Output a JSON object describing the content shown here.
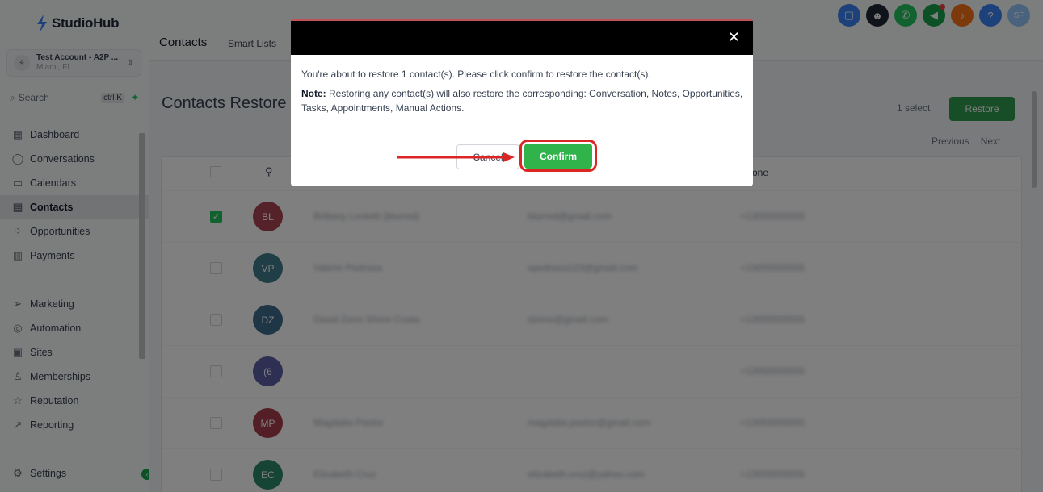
{
  "app": {
    "name": "StudioHub"
  },
  "account": {
    "name": "Test Account - A2P ...",
    "location": "Miami, FL"
  },
  "search": {
    "label": "Search",
    "shortcut": "ctrl K"
  },
  "sidebar": {
    "items": [
      {
        "label": "Dashboard",
        "icon": "dashboard-icon"
      },
      {
        "label": "Conversations",
        "icon": "chat-icon"
      },
      {
        "label": "Calendars",
        "icon": "calendar-icon"
      },
      {
        "label": "Contacts",
        "icon": "contacts-icon",
        "active": true
      },
      {
        "label": "Opportunities",
        "icon": "opportunities-icon"
      },
      {
        "label": "Payments",
        "icon": "payments-icon"
      }
    ],
    "items2": [
      {
        "label": "Marketing",
        "icon": "send-icon"
      },
      {
        "label": "Automation",
        "icon": "automation-icon"
      },
      {
        "label": "Sites",
        "icon": "sites-icon"
      },
      {
        "label": "Memberships",
        "icon": "memberships-icon"
      },
      {
        "label": "Reputation",
        "icon": "star-icon"
      },
      {
        "label": "Reporting",
        "icon": "reporting-icon"
      }
    ],
    "settings": "Settings"
  },
  "topnav": {
    "title": "Contacts",
    "tab": "Smart Lists"
  },
  "page": {
    "title": "Contacts Restore",
    "select_count": "1 select",
    "restore_label": "Restore",
    "previous": "Previous",
    "next": "Next",
    "phone_header": "one"
  },
  "rows": [
    {
      "initials": "BL",
      "color": "#a94450",
      "name": "Brittany Lockett (blurred)",
      "email": "blurred@gmail.com",
      "phone": "+13055555555",
      "checked": true
    },
    {
      "initials": "VP",
      "color": "#3f7d8a",
      "name": "Valerie Pedraza",
      "email": "vpedraza123@gmail.com",
      "phone": "+13055555555",
      "checked": false
    },
    {
      "initials": "DZ",
      "color": "#3f6c8e",
      "name": "David Zeno Shore Costa",
      "email": "dzeno@gmail.com",
      "phone": "+13055555555",
      "checked": false
    },
    {
      "initials": "(6",
      "color": "#5b5ea6",
      "name": "",
      "email": "",
      "phone": "+13055555555",
      "checked": false
    },
    {
      "initials": "MP",
      "color": "#a63d4a",
      "name": "Magdalia Pastor",
      "email": "magdalia.pastor@gmail.com",
      "phone": "+13055555555",
      "checked": false
    },
    {
      "initials": "EC",
      "color": "#2e8a6a",
      "name": "Elizabeth Cruz",
      "email": "elizabeth.cruz@yahoo.com",
      "phone": "+13055555555",
      "checked": false
    }
  ],
  "modal": {
    "message": "You're about to restore 1 contact(s). Please click confirm to restore the contact(s).",
    "note_label": "Note:",
    "note_text": " Restoring any contact(s) will also restore the corresponding: Conversation, Notes, Opportunities, Tasks, Appointments, Manual Actions.",
    "cancel_label": "Cancel",
    "confirm_label": "Confirm"
  },
  "top_icons": [
    {
      "icon": "chat-bubble-icon",
      "color": "#3b82f6"
    },
    {
      "icon": "bot-icon",
      "color": "#1f2937"
    },
    {
      "icon": "phone-icon",
      "color": "#22c55e"
    },
    {
      "icon": "megaphone-icon",
      "color": "#16a34a"
    },
    {
      "icon": "bell-icon",
      "color": "#f97316"
    },
    {
      "icon": "help-icon",
      "color": "#3b82f6"
    },
    {
      "icon": "user-avatar",
      "color": "#93c5fd",
      "text": "SF"
    }
  ]
}
